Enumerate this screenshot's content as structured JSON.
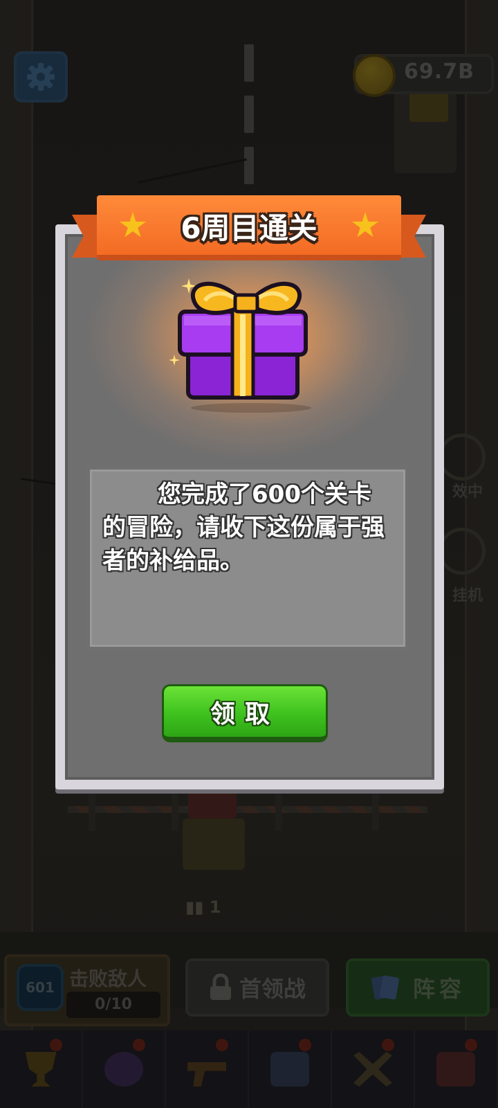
{
  "hud": {
    "coin_amount": "69.7B"
  },
  "ammo": {
    "count": "1"
  },
  "mission": {
    "level_badge": "601",
    "kill_title": "击败敌人",
    "kill_progress": "0/10",
    "leader_battle_label": "首领战",
    "lineup_label": "阵容"
  },
  "side_controls": {
    "auto_label": "效中",
    "machine_label": "挂机"
  },
  "tabs": [
    "trophy-icon",
    "team-icon",
    "weapon-icon",
    "book-icon",
    "swords-icon",
    "shop-icon"
  ],
  "dialog": {
    "title": "6周目通关",
    "message": "您完成了600个关卡的冒险，请收下这份属于强者的补给品。",
    "claim_label": "领取"
  },
  "colors": {
    "ribbon": "#f36b24",
    "star": "#f7c21c",
    "gift_box": "#9b2fe0",
    "gift_ribbon": "#f5b21c",
    "claim_button": "#3ec21e"
  }
}
